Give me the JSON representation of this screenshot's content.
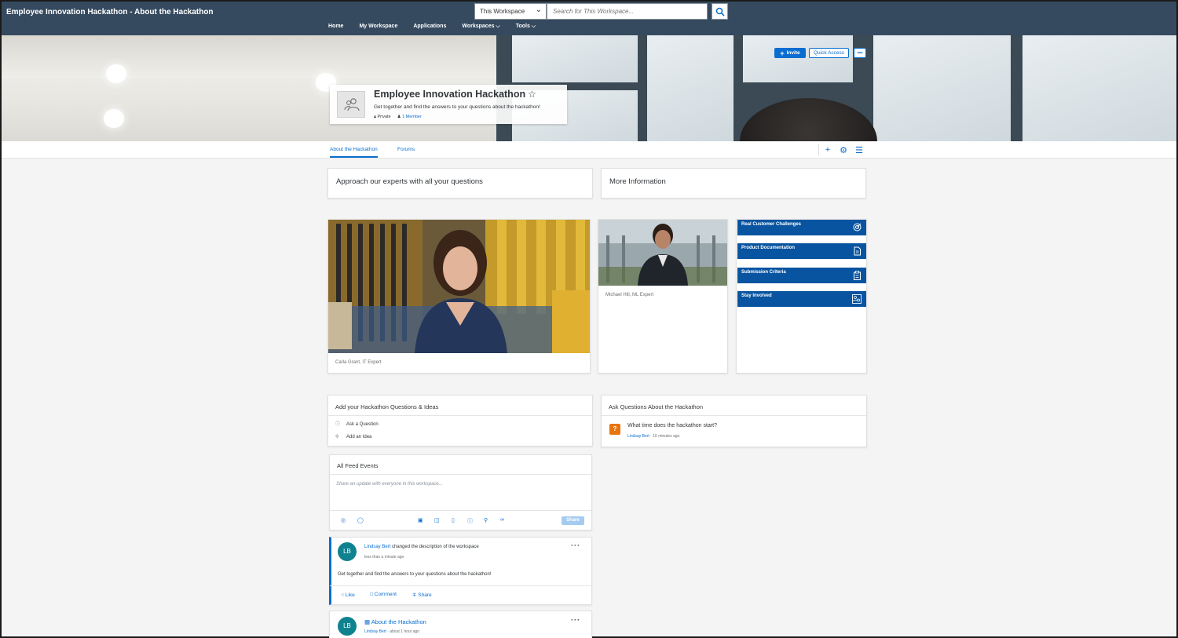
{
  "app": {
    "title": "Employee Innovation Hackathon - About the Hackathon"
  },
  "search": {
    "scope": "This Workspace",
    "placeholder": "Search for This Workspace..."
  },
  "nav": {
    "home": "Home",
    "my_workspace": "My Workspace",
    "applications": "Applications",
    "workspaces": "Workspaces",
    "tools": "Tools"
  },
  "workspace": {
    "name": "Employee Innovation Hackathon",
    "description": "Get together and find the answers to your questions about the hackathon!",
    "privacy": "Private",
    "members": "1 Member"
  },
  "header_buttons": {
    "invite": "Invite",
    "quick_access": "Quick Access",
    "more": "•••"
  },
  "tabs": {
    "about": "About the Hackathon",
    "forums": "Forums"
  },
  "cards": {
    "experts": "Approach our experts with all your questions",
    "more_info": "More Information"
  },
  "experts": {
    "carla": "Carla Grant, IT Expert",
    "michael": "Michael Hill, ML Expert"
  },
  "tiles": {
    "challenges": "Real Customer Challenges",
    "docs": "Product Documentation",
    "criteria": "Submission Criteria",
    "involved": "Stay Involved"
  },
  "ideas": {
    "title": "Add your Hackathon Questions & Ideas",
    "ask": "Ask a Question",
    "idea": "Add an Idea"
  },
  "questions": {
    "title": "Ask Questions About the Hackathon",
    "q1_text": "What time does the hackathon start?",
    "q1_author": "Lindsay Bert",
    "q1_time": "16 minutes ago"
  },
  "feed": {
    "title": "All Feed Events",
    "placeholder": "Share an update with everyone in this workspace...",
    "share": "Share",
    "post1": {
      "initials": "LB",
      "author": "Lindsay Bert",
      "action": "changed the description of the workspace",
      "time": "less than a minute ago",
      "body": "Get together and find the answers to your questions about the hackathon!",
      "like": "Like",
      "comment": "Comment",
      "share": "Share"
    },
    "post2": {
      "initials": "LB",
      "title": "About the Hackathon",
      "author": "Lindsay Bert",
      "time": "about 1 hour ago"
    }
  },
  "colors": {
    "shell": "#354a5f",
    "accent": "#0a6ed1",
    "tile": "#0854a0",
    "avatar": "#0f828f",
    "question": "#e9730c"
  }
}
